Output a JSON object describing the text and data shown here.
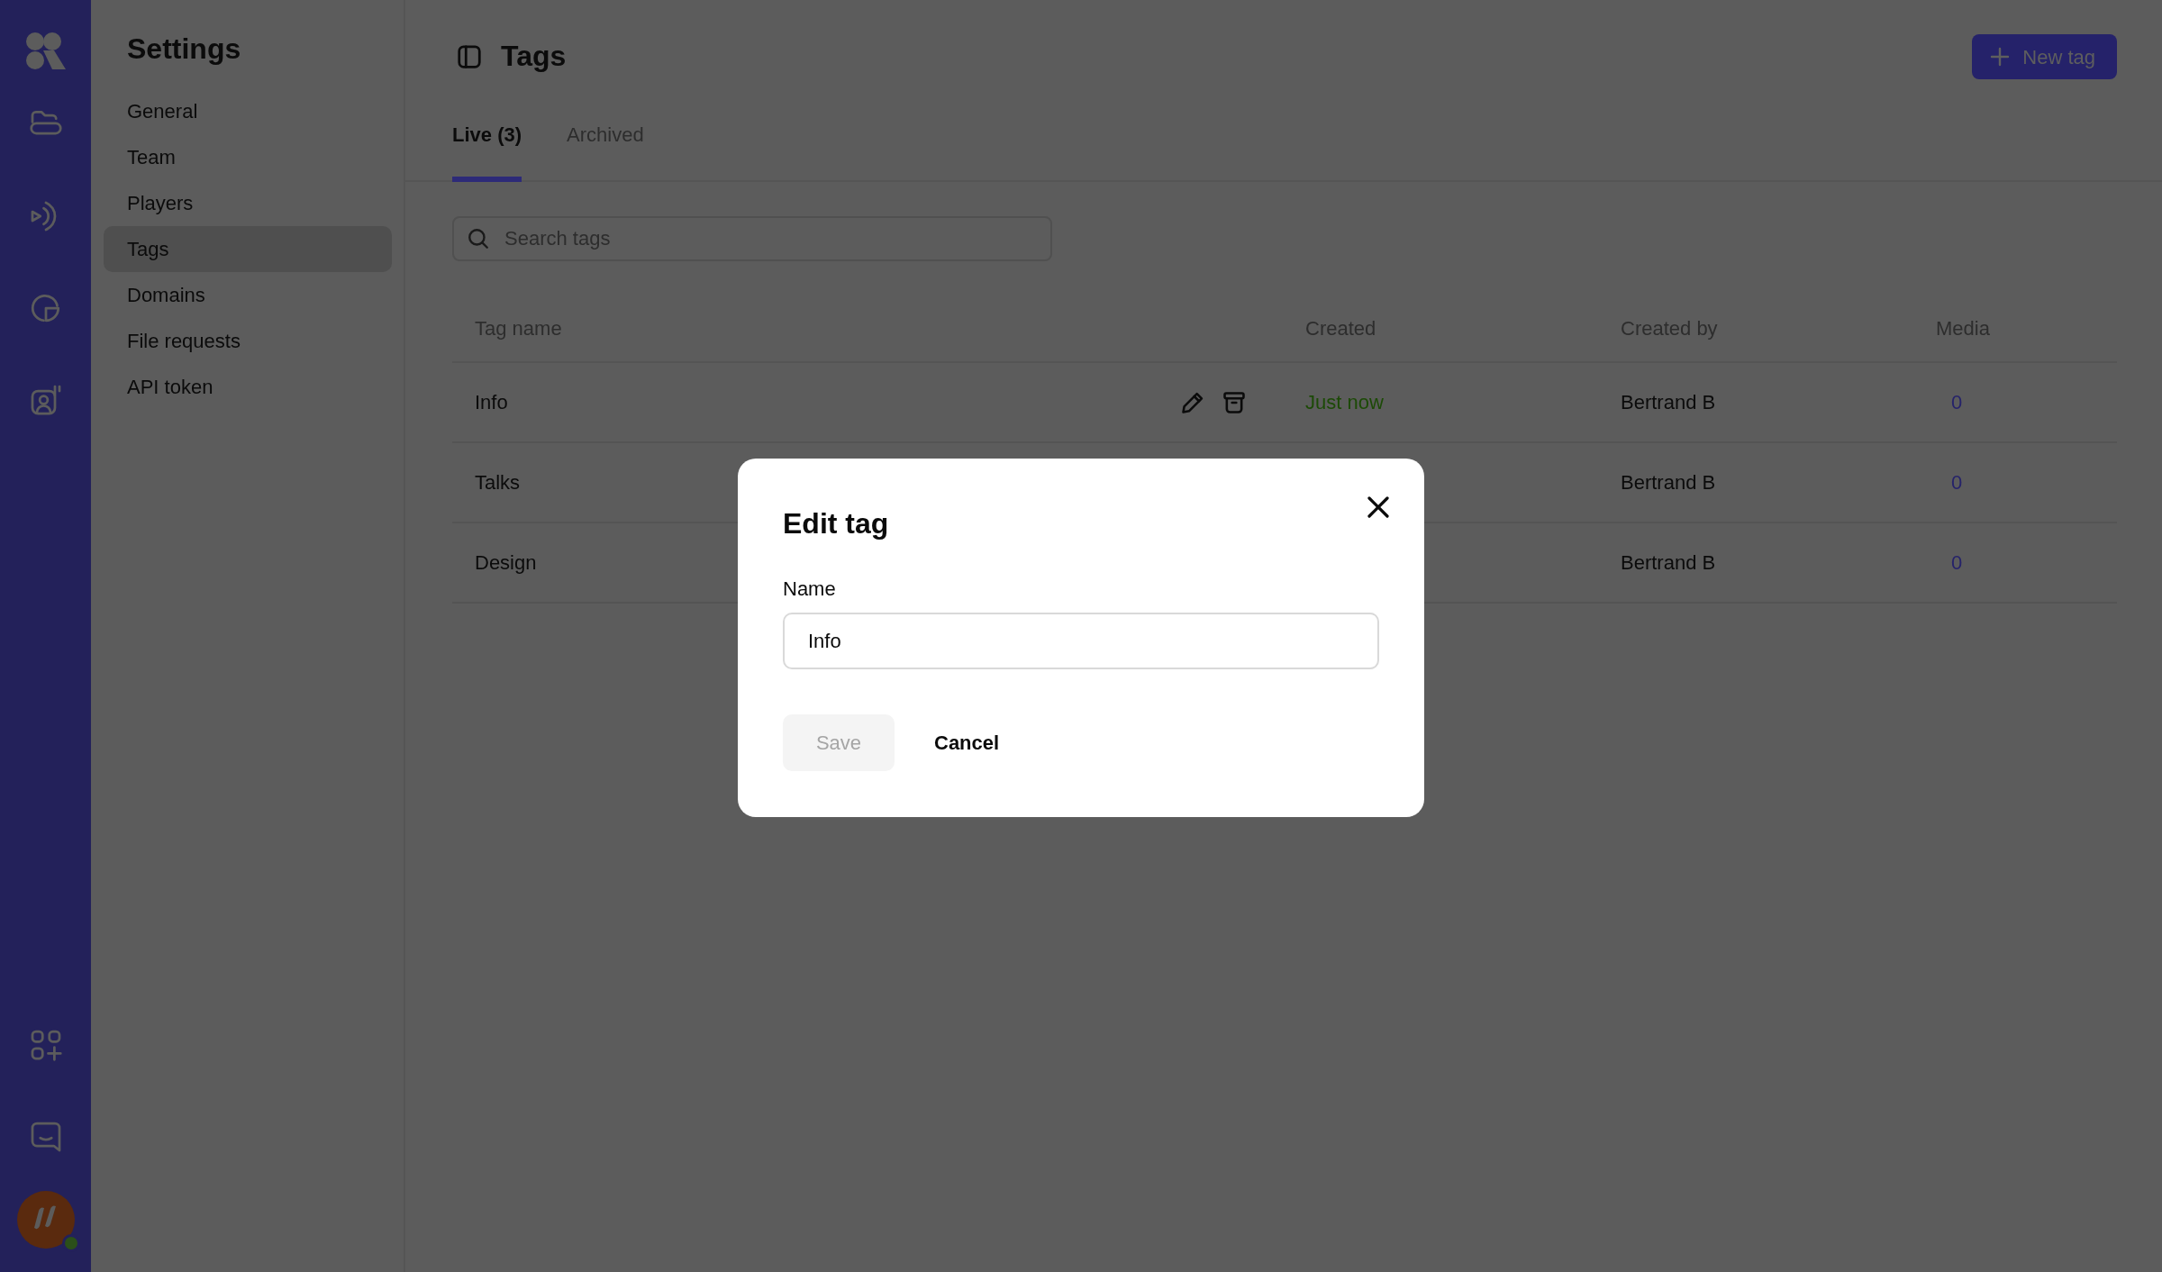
{
  "user": {
    "online": true
  },
  "settings": {
    "title": "Settings",
    "items": [
      {
        "label": "General",
        "selected": false
      },
      {
        "label": "Team",
        "selected": false
      },
      {
        "label": "Players",
        "selected": false
      },
      {
        "label": "Tags",
        "selected": true
      },
      {
        "label": "Domains",
        "selected": false
      },
      {
        "label": "File requests",
        "selected": false
      },
      {
        "label": "API token",
        "selected": false
      }
    ]
  },
  "header": {
    "title": "Tags",
    "new_button": "New tag"
  },
  "tabs": [
    {
      "label": "Live (3)",
      "selected": true
    },
    {
      "label": "Archived",
      "selected": false
    }
  ],
  "search": {
    "placeholder": "Search tags"
  },
  "table": {
    "columns": [
      "Tag name",
      "Created",
      "Created by",
      "Media"
    ],
    "rows": [
      {
        "name": "Info",
        "show_actions": true,
        "created": "Just now",
        "created_by": "Bertrand B",
        "media": "0"
      },
      {
        "name": "Talks",
        "show_actions": false,
        "created_by": "Bertrand B",
        "media": "0"
      },
      {
        "name": "Design",
        "show_actions": false,
        "created_by": "Bertrand B",
        "media": "0"
      }
    ]
  },
  "modal": {
    "title": "Edit tag",
    "field_label": "Name",
    "value": "Info",
    "save": {
      "label": "Save",
      "disabled": true
    },
    "cancel": "Cancel"
  }
}
